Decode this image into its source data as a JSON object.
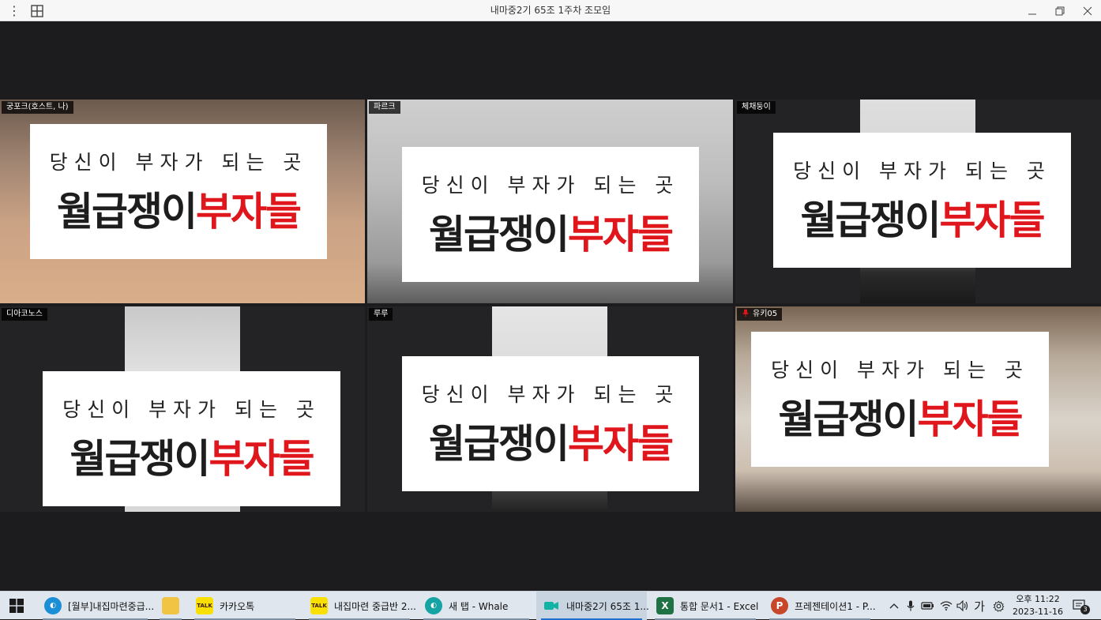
{
  "window": {
    "title": "내마중2기 65조 1주차 조모임"
  },
  "banner": {
    "sub": "당신이 부자가 되는 곳",
    "main_black": "월급쟁이",
    "main_red": "부자들"
  },
  "participants": [
    {
      "name": "궁포크(호스트, 나)",
      "active": true
    },
    {
      "name": "파르크",
      "active": true
    },
    {
      "name": "체채둥이",
      "active": false
    },
    {
      "name": "디아코노스",
      "active": false
    },
    {
      "name": "루루",
      "active": false
    },
    {
      "name": "유키05",
      "active": false,
      "muted": true
    }
  ],
  "taskbar": {
    "items": [
      {
        "label": "[월부]내집마련중급...",
        "icon": "whale-browser-icon"
      },
      {
        "label": "",
        "icon": "file-explorer-icon"
      },
      {
        "label": "카카오톡",
        "icon": "kakaotalk-icon"
      },
      {
        "label": "내집마련 중급반 2...",
        "icon": "kakaotalk-icon"
      },
      {
        "label": "새 탭 - Whale",
        "icon": "whale-browser-icon"
      },
      {
        "label": "내마중2기 65조 1...",
        "icon": "zoom-video-icon"
      },
      {
        "label": "통합 문서1 - Excel",
        "icon": "excel-icon"
      },
      {
        "label": "프레젠테이션1 - P...",
        "icon": "powerpoint-icon"
      }
    ],
    "ime": "가",
    "clock_time": "오후 11:22",
    "clock_date": "2023-11-16",
    "notifications": "3",
    "kakao_badge": "TALK"
  },
  "colors": {
    "active_border": "#1fbf9e",
    "brand_red": "#e0161d"
  }
}
